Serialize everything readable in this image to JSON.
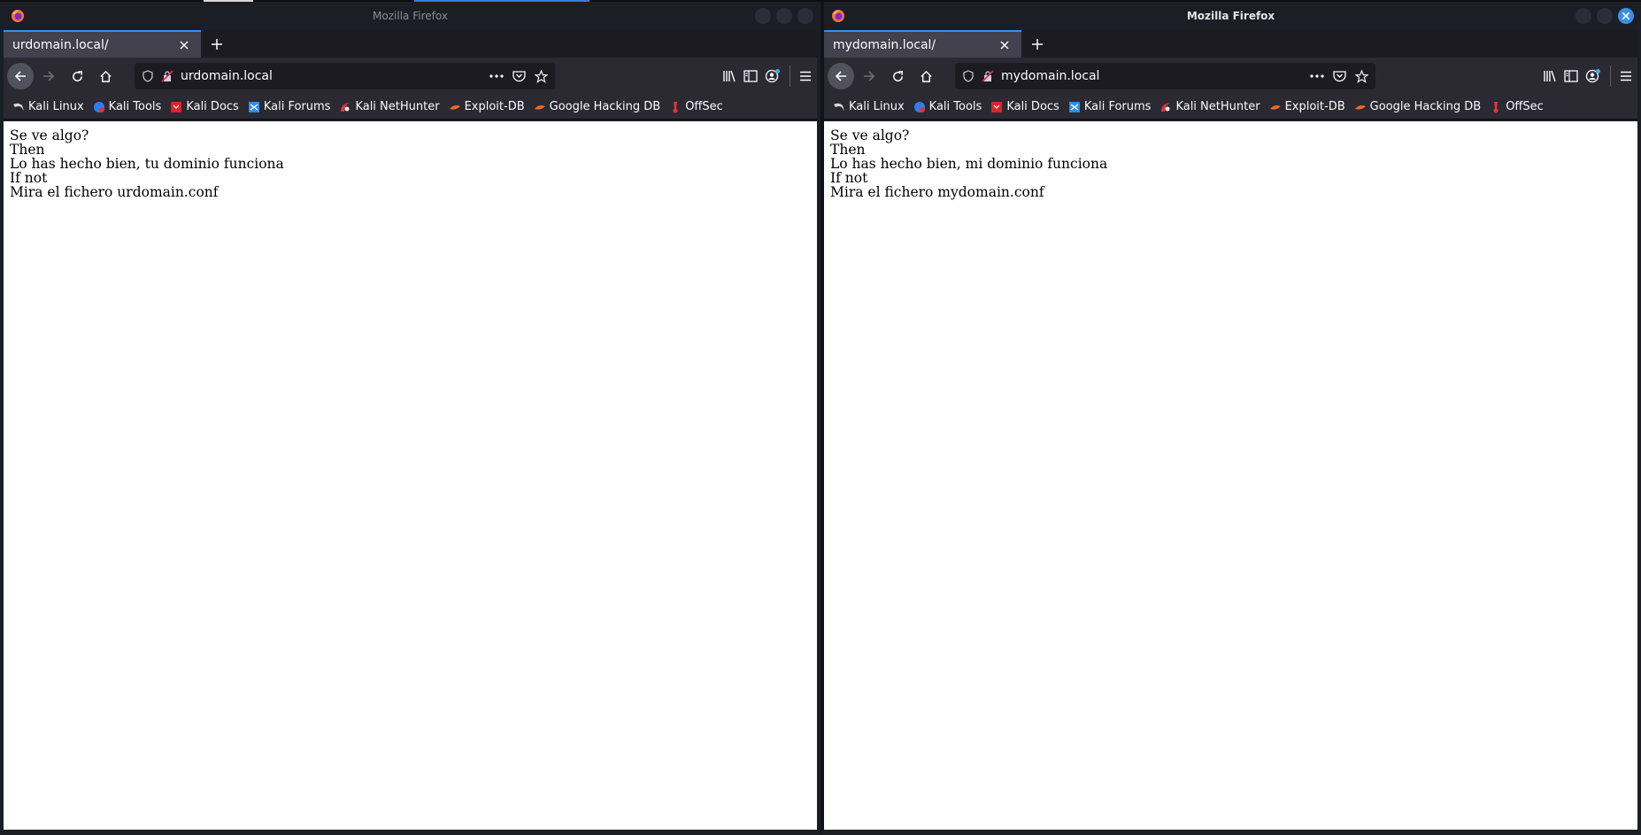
{
  "windows": [
    {
      "id": "left",
      "window_title": "Mozilla Firefox",
      "tab_title": "urdomain.local/",
      "url": "urdomain.local",
      "content_lines": [
        "Se ve algo?",
        "Then",
        "Lo has hecho bien, tu dominio funciona",
        "If not",
        "Mira el fichero urdomain.conf"
      ]
    },
    {
      "id": "right",
      "window_title": "Mozilla Firefox",
      "tab_title": "mydomain.local/",
      "url": "mydomain.local",
      "content_lines": [
        "Se ve algo?",
        "Then",
        "Lo has hecho bien, mi dominio funciona",
        "If not",
        "Mira el fichero mydomain.conf"
      ]
    }
  ],
  "bookmarks": [
    {
      "label": "Kali Linux",
      "icon": "kali-dragon-icon"
    },
    {
      "label": "Kali Tools",
      "icon": "kali-tools-icon"
    },
    {
      "label": "Kali Docs",
      "icon": "kali-docs-icon"
    },
    {
      "label": "Kali Forums",
      "icon": "kali-forums-icon"
    },
    {
      "label": "Kali NetHunter",
      "icon": "nethunter-icon"
    },
    {
      "label": "Exploit-DB",
      "icon": "exploit-db-icon"
    },
    {
      "label": "Google Hacking DB",
      "icon": "ghdb-icon"
    },
    {
      "label": "OffSec",
      "icon": "offsec-icon"
    }
  ],
  "colors": {
    "accent": "#3a8fe8",
    "titlebar": "#1c1e26",
    "toolbar": "#2b2a33",
    "tab_active": "#42414d",
    "page_bg": "#ffffff"
  }
}
